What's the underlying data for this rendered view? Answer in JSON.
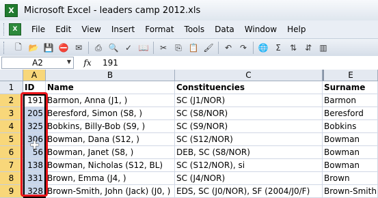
{
  "window": {
    "title": "Microsoft Excel - leaders camp 2012.xls"
  },
  "menu": [
    "File",
    "Edit",
    "View",
    "Insert",
    "Format",
    "Tools",
    "Data",
    "Window",
    "Help"
  ],
  "toolbar_icons": [
    "new-icon",
    "open-icon",
    "save-icon",
    "permission-icon",
    "email-icon",
    "print-icon",
    "print-preview-icon",
    "spelling-icon",
    "research-icon",
    "cut-icon",
    "copy-icon",
    "paste-icon",
    "format-painter-icon",
    "undo-icon",
    "redo-icon",
    "hyperlink-icon",
    "autosum-icon",
    "sort-ascending-icon",
    "sort-descending-icon",
    "chart-icon"
  ],
  "formula_bar": {
    "name_box": "A2",
    "fx": "fx",
    "formula": "191"
  },
  "columns": [
    "A",
    "B",
    "C",
    "E"
  ],
  "rows": [
    {
      "num": "1",
      "a": "ID",
      "b": "Name",
      "c": "Constituencies",
      "e": "Surname"
    },
    {
      "num": "2",
      "a": "191",
      "b": "Barmon, Anna (J1, )",
      "c": "SC (J1/NOR)",
      "e": "Barmon"
    },
    {
      "num": "3",
      "a": "205",
      "b": "Beresford, Simon (S8, )",
      "c": "SC (S8/NOR)",
      "e": "Beresford"
    },
    {
      "num": "4",
      "a": "325",
      "b": "Bobkins, Billy-Bob (S9, )",
      "c": "SC (S9/NOR)",
      "e": "Bobkins"
    },
    {
      "num": "5",
      "a": "306",
      "b": "Bowman, Dana (S12, )",
      "c": "SC (S12/NOR)",
      "e": "Bowman"
    },
    {
      "num": "6",
      "a": "56",
      "b": "Bowman, Janet (S8, )",
      "c": "DEB, SC (S8/NOR)",
      "e": "Bowman"
    },
    {
      "num": "7",
      "a": "138",
      "b": "Bowman, Nicholas (S12, BL)",
      "c": "SC (S12/NOR), si",
      "e": "Bowman"
    },
    {
      "num": "8",
      "a": "331",
      "b": "Brown, Emma (J4, )",
      "c": "SC (J4/NOR)",
      "e": "Brown"
    },
    {
      "num": "9",
      "a": "328",
      "b": "Brown-Smith, John (Jack) (J0, )",
      "c": "EDS, SC (J0/NOR), SF (2004/J0/F)",
      "e": "Brown-Smith"
    }
  ],
  "colors": {
    "highlight": "#e8151b",
    "selection": "#c8d6ea",
    "header": "#e4e9f1",
    "header_selected": "#f8d77a"
  }
}
